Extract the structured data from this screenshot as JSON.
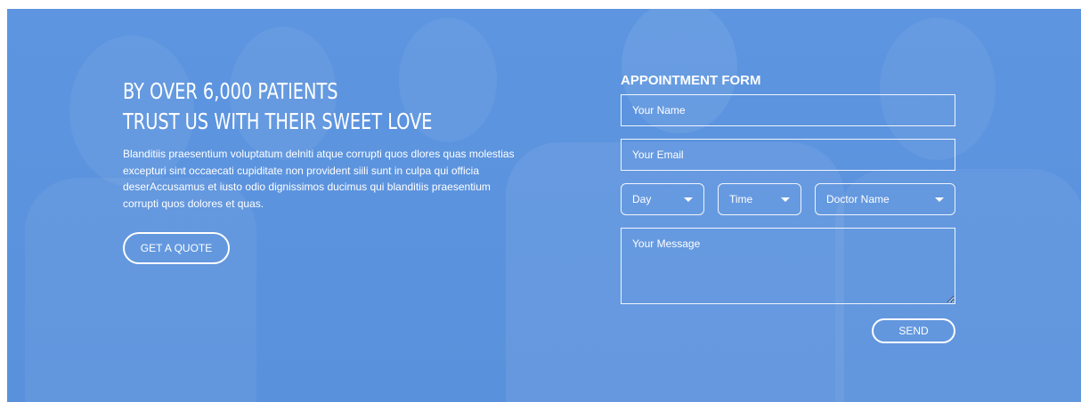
{
  "hero": {
    "headline_line1": "BY OVER 6,000 PATIENTS",
    "headline_line2": "TRUST US WITH THEIR SWEET LOVE",
    "paragraph": "Blanditiis praesentium voluptatum delniti atque corrupti quos dlores quas molestias excepturi sint occaecati cupiditate non provident siili sunt in culpa qui officia deserAccusamus et iusto odio dignissimos ducimus qui blanditiis praesentium corrupti quos dolores et quas.",
    "quote_button": "GET A QUOTE"
  },
  "form": {
    "title": "APPOINTMENT FORM",
    "name_placeholder": "Your Name",
    "email_placeholder": "Your Email",
    "day_label": "Day",
    "time_label": "Time",
    "doctor_label": "Doctor Name",
    "message_placeholder": "Your Message",
    "send_button": "SEND"
  },
  "colors": {
    "background": "#5b93de",
    "text": "#ffffff"
  },
  "icons": {
    "dropdown": "caret-down-icon"
  }
}
